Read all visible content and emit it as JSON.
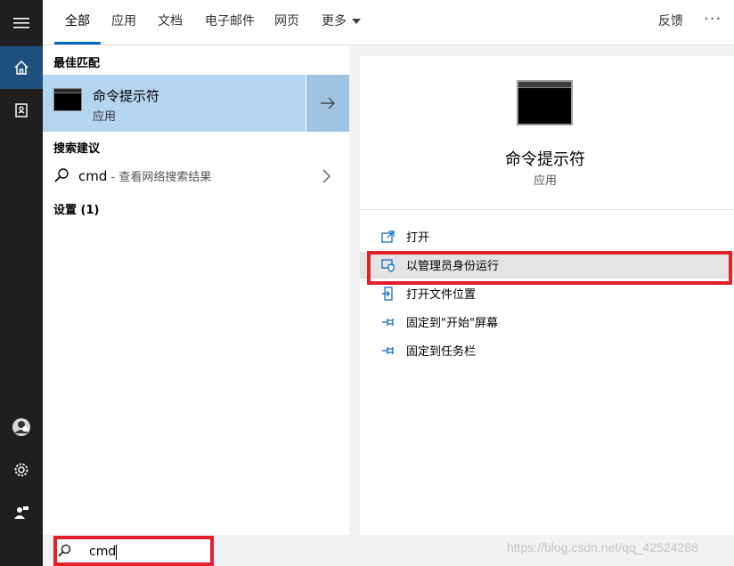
{
  "tabs": [
    {
      "label": "全部",
      "active": true
    },
    {
      "label": "应用"
    },
    {
      "label": "文档"
    },
    {
      "label": "电子邮件"
    },
    {
      "label": "网页"
    },
    {
      "label": "更多"
    }
  ],
  "header": {
    "feedback": "反馈",
    "more_options": "···"
  },
  "rail": {
    "icons": [
      "menu-icon",
      "home-icon",
      "notebook-icon",
      "avatar",
      "gear-icon",
      "person-feedback-icon"
    ]
  },
  "results": {
    "best_match_title": "最佳匹配",
    "best_match": {
      "name": "命令提示符",
      "type": "应用"
    },
    "suggestions_title": "搜索建议",
    "suggestion": {
      "query": "cmd",
      "hint": " - 查看网络搜索结果"
    },
    "settings_title": "设置 (1)"
  },
  "detail": {
    "name": "命令提示符",
    "type": "应用",
    "actions": [
      {
        "label": "打开",
        "icon": "open-icon"
      },
      {
        "label": "以管理员身份运行",
        "icon": "shield-icon"
      },
      {
        "label": "打开文件位置",
        "icon": "folder-icon"
      },
      {
        "label": "固定到\"开始\"屏幕",
        "icon": "pin-icon"
      },
      {
        "label": "固定到任务栏",
        "icon": "pin-icon"
      }
    ]
  },
  "search": {
    "value": "cmd"
  },
  "watermark": "https://blog.csdn.net/qq_42524288",
  "colors": {
    "accent": "#0067c0",
    "selection": "#b4d5f0",
    "highlight": "#e5202a",
    "rail": "#1f1f1f"
  }
}
